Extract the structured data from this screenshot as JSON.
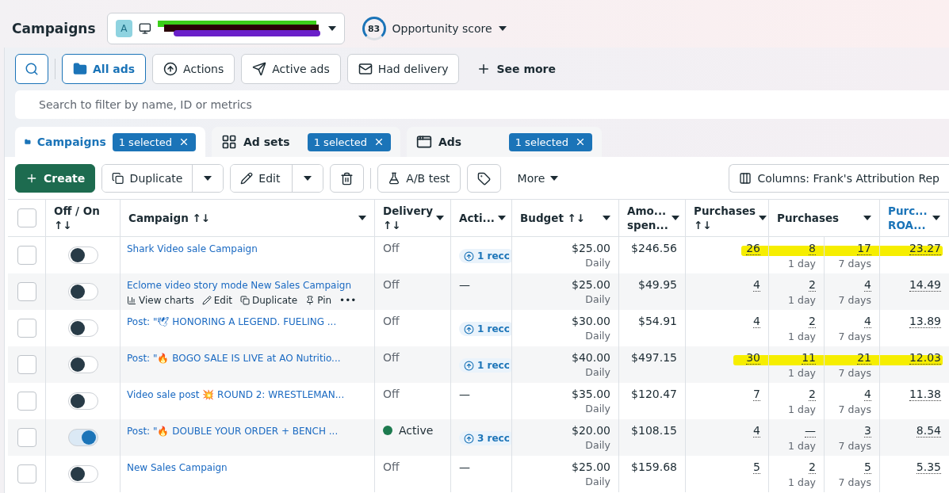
{
  "header": {
    "title": "Campaigns",
    "account": {
      "initial": "A"
    },
    "score": {
      "value": "83",
      "label": "Opportunity score"
    }
  },
  "filters": [
    {
      "label": "All ads",
      "kind": "folder",
      "selected": true
    },
    {
      "label": "Actions",
      "kind": "actions",
      "selected": false
    },
    {
      "label": "Active ads",
      "kind": "send",
      "selected": false
    },
    {
      "label": "Had delivery",
      "kind": "mail",
      "selected": false
    },
    {
      "label": "See more",
      "kind": "plus",
      "selected": false
    }
  ],
  "search": {
    "placeholder": "Search to filter by name, ID or metrics"
  },
  "tabs": [
    {
      "label": "Campaigns",
      "kind": "campaigns",
      "badge": "1 selected",
      "selected": true
    },
    {
      "label": "Ad sets",
      "kind": "adsets",
      "badge": "1 selected",
      "selected": false
    },
    {
      "label": "Ads",
      "kind": "ads",
      "badge": "1 selected",
      "selected": false
    }
  ],
  "toolbar": {
    "create": "Create",
    "duplicate": "Duplicate",
    "edit": "Edit",
    "ab_test": "A/B test",
    "more": "More",
    "columns": "Columns: Frank's Attribution Rep"
  },
  "table": {
    "select_all_checked": false,
    "columns": [
      {
        "label": "Off / On",
        "sort": "↑↓",
        "menu": false,
        "link": false
      },
      {
        "label": "Campaign",
        "sort": "↑↓",
        "menu": true,
        "link": false
      },
      {
        "label": "Delivery",
        "sort": "↑↓",
        "menu": true,
        "link": false
      },
      {
        "label": "Acti...",
        "menu": true,
        "link": false
      },
      {
        "label": "Budget",
        "sort": "↑↓",
        "menu": true,
        "link": false
      },
      {
        "label": "Amo... spen...",
        "menu": true,
        "link": false
      },
      {
        "label": "Purchases",
        "sort": "↑↓",
        "menu": true,
        "link": false
      },
      {
        "label": "Purchases",
        "menu": true,
        "link": false
      },
      {
        "label": "Purc... ROA...",
        "menu": true,
        "link": true
      }
    ],
    "rows": [
      {
        "checked": false,
        "on": false,
        "name": "Shark Video sale Campaign",
        "delivery": "Off",
        "active": false,
        "action": {
          "kind": "recommendation",
          "text": "1 recc"
        },
        "budget": "$25.00",
        "period": "Daily",
        "spent": "$246.56",
        "purchases": "26",
        "day1": "8",
        "day1_label": "1 day",
        "day7": "17",
        "day7_label": "7 days",
        "roas": "23.27",
        "highlighted": true
      },
      {
        "checked": false,
        "on": false,
        "name": "Eclome video story mode New Sales Campaign",
        "hover_actions": [
          "View charts",
          "Edit",
          "Duplicate",
          "Pin",
          "•••"
        ],
        "delivery": "Off",
        "active": false,
        "action": {
          "kind": "none",
          "text": "—"
        },
        "budget": "$25.00",
        "period": "Daily",
        "spent": "$49.95",
        "purchases": "4",
        "day1": "2",
        "day1_label": "1 day",
        "day7": "4",
        "day7_label": "7 days",
        "roas": "14.49",
        "highlighted": false
      },
      {
        "checked": false,
        "on": false,
        "name": "Post: \"🕊 HONORING A LEGEND. FUELING ...",
        "delivery": "Off",
        "active": false,
        "action": {
          "kind": "recommendation",
          "text": "1 recc"
        },
        "budget": "$30.00",
        "period": "Daily",
        "spent": "$54.91",
        "purchases": "4",
        "day1": "2",
        "day1_label": "1 day",
        "day7": "4",
        "day7_label": "7 days",
        "roas": "13.89",
        "highlighted": false
      },
      {
        "checked": false,
        "on": false,
        "name": "Post: \"🔥 BOGO SALE IS LIVE at AO Nutritio...",
        "delivery": "Off",
        "active": false,
        "action": {
          "kind": "recommendation",
          "text": "1 recc"
        },
        "budget": "$40.00",
        "period": "Daily",
        "spent": "$497.15",
        "purchases": "30",
        "day1": "11",
        "day1_label": "1 day",
        "day7": "21",
        "day7_label": "7 days",
        "roas": "12.03",
        "highlighted": true
      },
      {
        "checked": false,
        "on": false,
        "name": "Video sale post 💥 ROUND 2: WRESTLEMAN...",
        "delivery": "Off",
        "active": false,
        "action": {
          "kind": "none",
          "text": "—"
        },
        "budget": "$35.00",
        "period": "Daily",
        "spent": "$120.47",
        "purchases": "7",
        "day1": "2",
        "day1_label": "1 day",
        "day7": "4",
        "day7_label": "7 days",
        "roas": "11.38",
        "highlighted": false
      },
      {
        "checked": false,
        "on": true,
        "name": "Post: \"🔥 DOUBLE YOUR ORDER + BENCH ...",
        "delivery": "Active",
        "active": true,
        "action": {
          "kind": "recommendation",
          "text": "3 recc"
        },
        "budget": "$20.00",
        "period": "Daily",
        "spent": "$108.15",
        "purchases": "4",
        "day1": "—",
        "day1_label": "1 day",
        "day7": "3",
        "day7_label": "7 days",
        "roas": "8.54",
        "highlighted": false
      },
      {
        "checked": false,
        "on": false,
        "name": "New Sales Campaign",
        "delivery": "Off",
        "active": false,
        "action": {
          "kind": "none",
          "text": "—"
        },
        "budget": "$25.00",
        "period": "Daily",
        "spent": "$159.68",
        "purchases": "5",
        "day1": "2",
        "day1_label": "1 day",
        "day7": "5",
        "day7_label": "7 days",
        "roas": "5.35",
        "highlighted": false
      }
    ]
  }
}
